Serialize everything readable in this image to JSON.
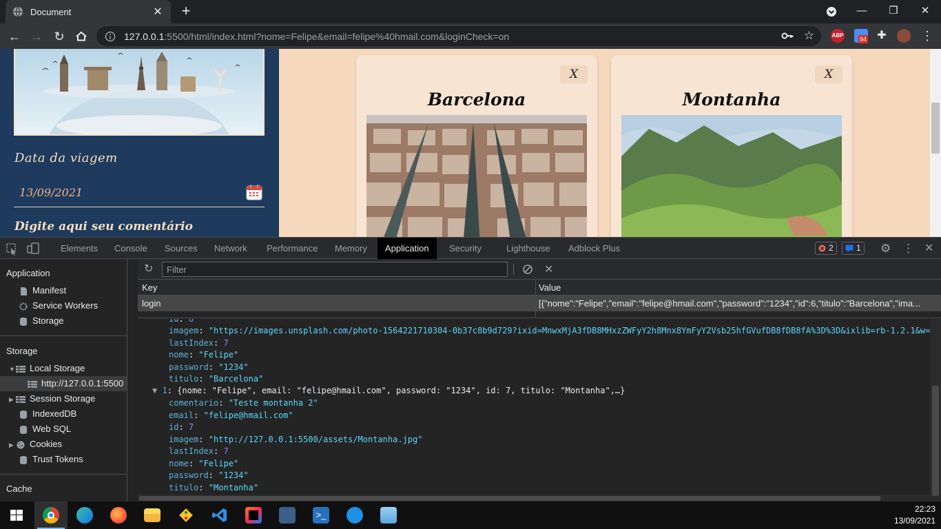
{
  "browser": {
    "tab_title": "Document",
    "url_host": "127.0.0.1",
    "url_rest": ":5500/html/index.html?nome=Felipe&email=felipe%40hmail.com&loginCheck=on",
    "abp_label": "ABP",
    "ext_badge": "94",
    "new_tab": "+"
  },
  "page": {
    "date_label": "Data da viagem",
    "date_value": "13/09/2021",
    "comment_label": "Digite aqui seu comentário",
    "cards": [
      {
        "title": "Barcelona",
        "close": "X"
      },
      {
        "title": "Montanha",
        "close": "X"
      }
    ]
  },
  "devtools": {
    "tabs": [
      "Elements",
      "Console",
      "Sources",
      "Network",
      "Performance",
      "Memory",
      "Application",
      "Security",
      "Lighthouse",
      "Adblock Plus"
    ],
    "active_tab": "Application",
    "errors": "2",
    "messages": "1",
    "sidebar": {
      "application_head": "Application",
      "app_items": [
        "Manifest",
        "Service Workers",
        "Storage"
      ],
      "storage_head": "Storage",
      "local_storage": "Local Storage",
      "local_origin": "http://127.0.0.1:5500",
      "storage_items": [
        "Session Storage",
        "IndexedDB",
        "Web SQL",
        "Cookies",
        "Trust Tokens"
      ],
      "cache_head": "Cache"
    },
    "filter_placeholder": "Filter",
    "table": {
      "col_key": "Key",
      "col_value": "Value",
      "row_key": "login",
      "row_value": "[{\"nome\":\"Felipe\",\"email\":\"felipe@hmail.com\",\"password\":\"1234\",\"id\":6,\"titulo\":\"Barcelona\",\"ima..."
    },
    "json": {
      "img0_key": "imagem",
      "img0_val": "\"https://images.unsplash.com/photo-1564221710304-0b37c8b9d729?ixid=MnwxMjA3fDB8MHxzZWFyY2h8Mnx8YmFyY2Vsb25hfGVufDB8fDB8fA%3D%3D&ixlib=rb-1.2.1&w=",
      "li0_key": "lastIndex",
      "li0_val": "7",
      "nome0_key": "nome",
      "nome0_val": "\"Felipe\"",
      "pw0_key": "password",
      "pw0_val": "\"1234\"",
      "tit0_key": "titulo",
      "tit0_val": "\"Barcelona\"",
      "item1_index": "1",
      "item1_summary": "{nome: \"Felipe\", email: \"felipe@hmail.com\", password: \"1234\", id: 7, titulo: \"Montanha\",…}",
      "com1_key": "comentario",
      "com1_val": "\"Teste montanha 2\"",
      "email1_key": "email",
      "email1_val": "\"felipe@hmail.com\"",
      "id1_key": "id",
      "id1_val": "7",
      "img1_key": "imagem",
      "img1_val": "\"http://127.0.0.1:5500/assets/Montanha.jpg\"",
      "li1_key": "lastIndex",
      "li1_val": "7",
      "nome1_key": "nome",
      "nome1_val": "\"Felipe\"",
      "pw1_key": "password",
      "pw1_val": "\"1234\"",
      "tit1_key": "titulo",
      "tit1_val": "\"Montanha\""
    }
  },
  "taskbar": {
    "time": "22:23",
    "date": "13/09/2021",
    "apps": [
      "chrome",
      "edge",
      "firefox",
      "file-explorer",
      "git",
      "vscode",
      "intellij",
      "sql-server",
      "powershell",
      "docker",
      "notepad"
    ]
  },
  "colors": {
    "page_bg": "#f6d9bd",
    "left_panel": "#1e3a5c",
    "card_bg": "#f7e4d2",
    "devtools_bg": "#242424"
  }
}
